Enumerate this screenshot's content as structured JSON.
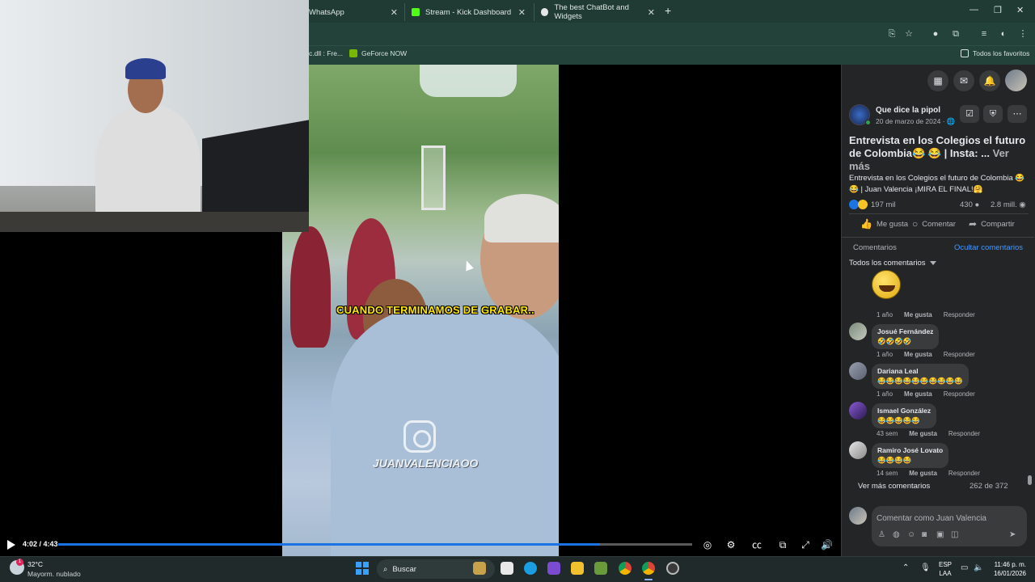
{
  "browser": {
    "tabs": [
      {
        "title": "WhatsApp",
        "icon": "whatsapp-icon"
      },
      {
        "title": "Stream - Kick Dashboard",
        "icon": "kick-icon",
        "color": "#53fc18"
      },
      {
        "title": "The best ChatBot and Widgets",
        "icon": "streamelements-icon"
      }
    ],
    "new_tab": "+",
    "bookmarks": [
      {
        "label": "c.dll : Fre..."
      },
      {
        "label": "GeForce NOW",
        "color": "#76b900"
      }
    ],
    "all_bookmarks": "Todos los favoritos"
  },
  "video": {
    "caption": "CUANDO TERMINAMOS DE GRABAR..",
    "watermark": "JUANVALENCIAOO",
    "time": "4:02 / 4:43",
    "progress": 0.854,
    "accent": "#1b74e4"
  },
  "post": {
    "page_name": "Que dice la pipol",
    "date": "20 de marzo de 2024 · ",
    "title": "Entrevista en los Colegios el futuro de Colombia😂 😂 | Insta: ...",
    "see_more": "Ver más",
    "description": "Entrevista en los Colegios el futuro de Colombia 😂😂 | Juan Valencia ¡MIRA EL FINAL!🤗",
    "reactions": "197 mil",
    "comments_count": "430",
    "views": "2.8 mill.",
    "actions": {
      "like": "Me gusta",
      "comment": "Comentar",
      "share": "Compartir"
    }
  },
  "comments": {
    "header": "Comentarios",
    "hide": "Ocultar comentarios",
    "filter": "Todos los comentarios",
    "first_meta": {
      "age": "1 año",
      "like": "Me gusta",
      "reply": "Responder"
    },
    "items": [
      {
        "name": "Josué Fernández",
        "text": "🤣🤣🤣🤣",
        "age": "1 año",
        "like": "Me gusta",
        "reply": "Responder"
      },
      {
        "name": "Dariana Leal",
        "text": "😂😂😂😂😂😂😂😂😂😂",
        "age": "1 año",
        "like": "Me gusta",
        "reply": "Responder"
      },
      {
        "name": "Ismael González",
        "text": "😂😂😂😂😂",
        "age": "43 sem",
        "like": "Me gusta",
        "reply": "Responder"
      },
      {
        "name": "Ramiro José Lovato",
        "text": "😂😂😂😂",
        "age": "14 sem",
        "like": "Me gusta",
        "reply": "Responder"
      }
    ],
    "see_more": "Ver más comentarios",
    "count": "262 de 372",
    "input_placeholder": "Comentar como Juan Valencia"
  },
  "taskbar": {
    "temp": "32°C",
    "condition": "Mayorm. nublado",
    "weather_badge": "1",
    "search": "Buscar",
    "lang_top": "ESP",
    "lang_bottom": "LAA",
    "time": "11:46 p. m.",
    "date": "16/01/2026"
  }
}
